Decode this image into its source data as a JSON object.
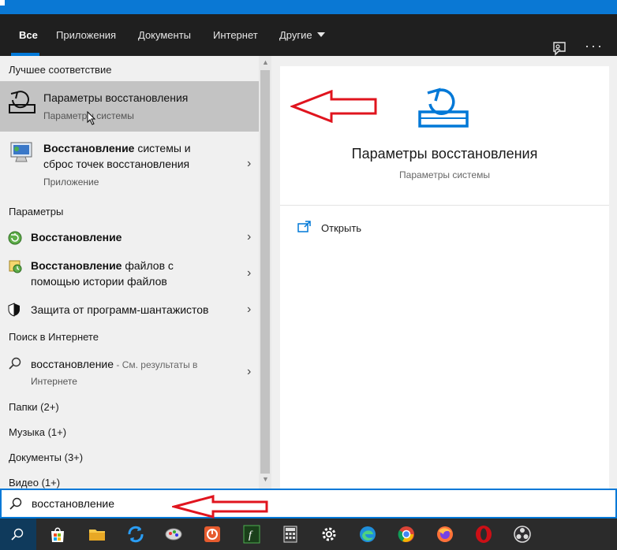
{
  "tabs": {
    "all": "Все",
    "apps": "Приложения",
    "documents": "Документы",
    "web": "Интернет",
    "more": "Другие"
  },
  "top_right": {
    "dots": "···"
  },
  "sections": {
    "best_match": "Лучшее соответствие",
    "settings": "Параметры",
    "web_search": "Поиск в Интернете"
  },
  "best_match": {
    "title": "Параметры восстановления",
    "subtitle": "Параметры системы"
  },
  "app_result": {
    "title_bold": "Восстановление",
    "title_rest_line1": " системы и",
    "title_line2": "сброс точек восстановления",
    "subtitle": "Приложение"
  },
  "settings_items": [
    {
      "bold": "Восстановление",
      "rest": "",
      "line2": ""
    },
    {
      "bold": "Восстановление",
      "rest": " файлов с",
      "line2": "помощью истории файлов"
    },
    {
      "bold": "",
      "rest": "Защита от программ-шантажистов",
      "line2": ""
    }
  ],
  "web_item": {
    "query": "восстановление",
    "suffix": " - См. результаты в",
    "line2": "Интернете"
  },
  "categories": [
    "Папки (2+)",
    "Музыка (1+)",
    "Документы (3+)",
    "Видео (1+)"
  ],
  "preview": {
    "title": "Параметры восстановления",
    "subtitle": "Параметры системы",
    "open_label": "Открыть"
  },
  "search": {
    "value": "восстановление"
  },
  "taskbar_icons": [
    "search-icon",
    "store-icon",
    "file-explorer-icon",
    "sync-icon",
    "paint-icon",
    "recorder-icon",
    "formula-icon",
    "calculator-icon",
    "settings-icon",
    "edge-icon",
    "chrome-icon",
    "firefox-icon",
    "opera-icon",
    "obs-icon"
  ],
  "colors": {
    "accent": "#0078d7",
    "annotation_arrow": "#e0141e",
    "selected_row": "#c3c3c3"
  }
}
